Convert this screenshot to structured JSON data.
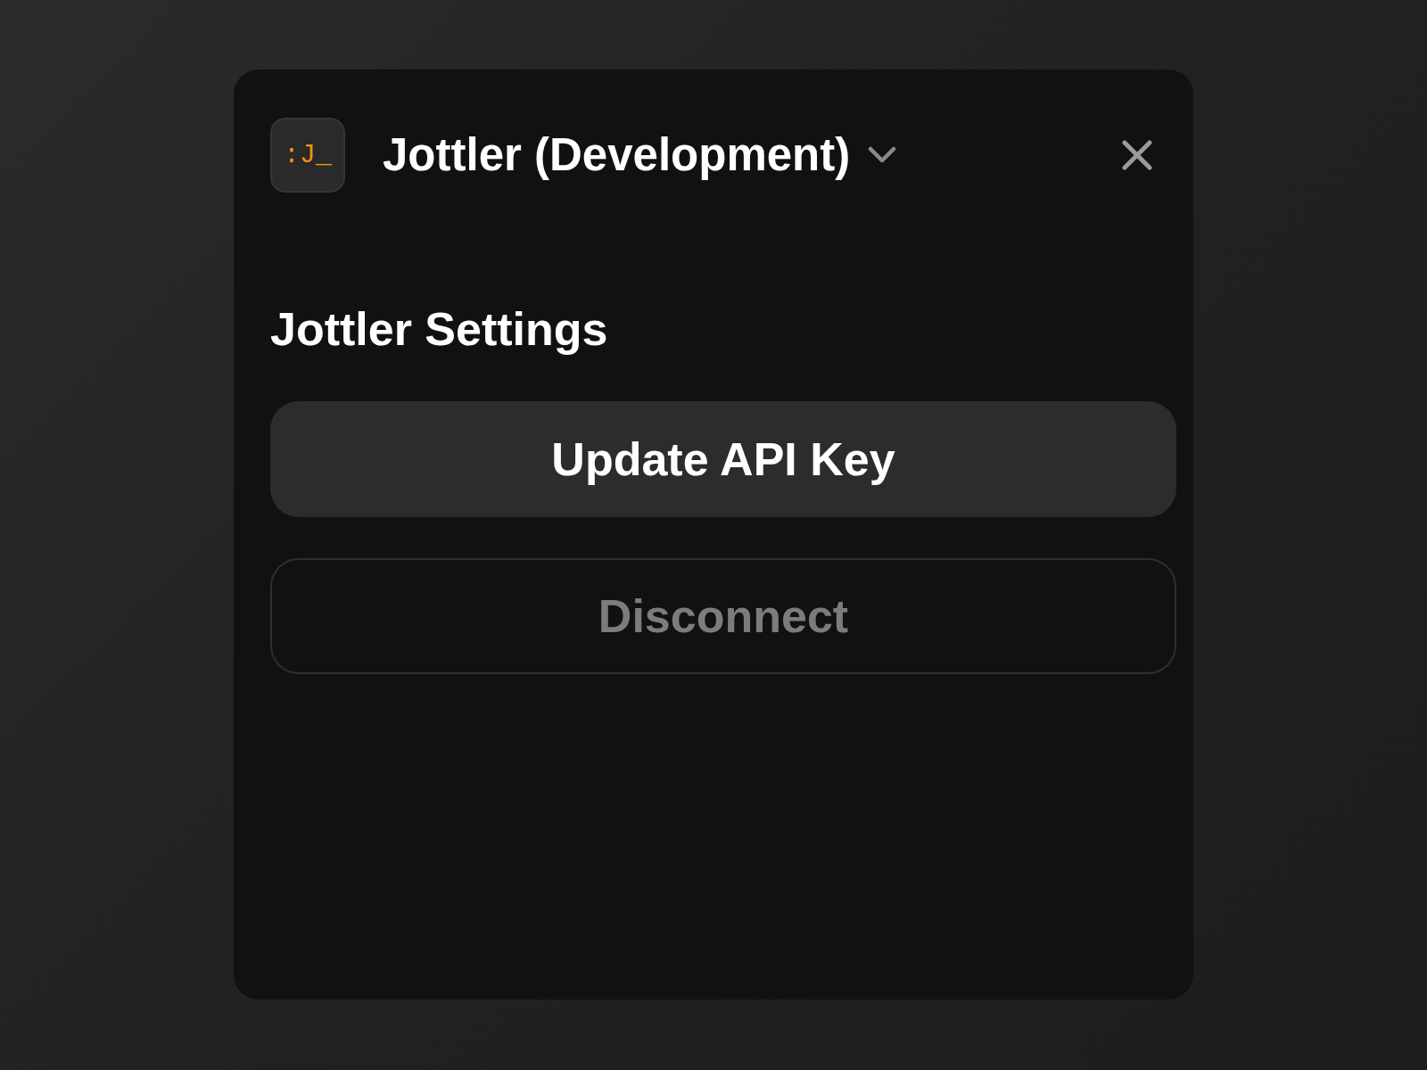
{
  "header": {
    "logo": ":J_",
    "title": "Jottler (Development)"
  },
  "section": {
    "heading": "Jottler Settings"
  },
  "buttons": [
    {
      "label": "Update API Key",
      "kind": "filled"
    },
    {
      "label": "Disconnect",
      "kind": "outline"
    }
  ]
}
